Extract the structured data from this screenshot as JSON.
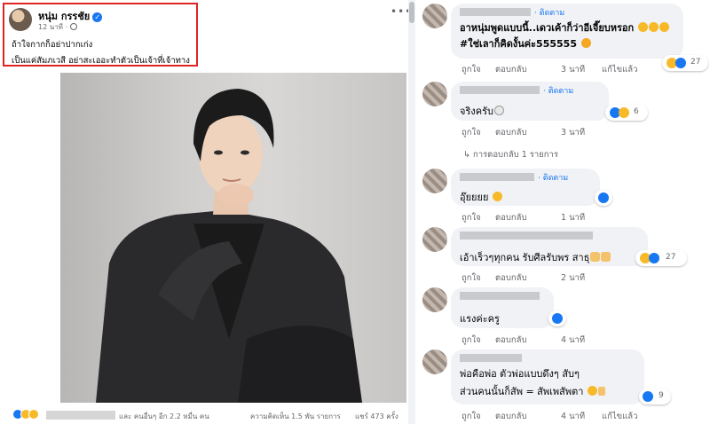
{
  "post": {
    "author": "หนุ่ม กรรชัย",
    "time": "12 นาที ·",
    "text_line_1": "ถ้าใจกากก็อย่าปากเก่ง",
    "text_line_2": "เป็นแค่สัมภเวสี อย่าสะเออะทำตัวเป็นเจ้าที่เจ้าทาง",
    "more_icon": "•••",
    "reaction_summary": "และ คนอื่นๆ อีก 2.2 หมื่น คน",
    "comment_count": "ความคิดเห็น 1.5 พัน รายการ",
    "share_count": "แชร์ 473 ครั้ง",
    "reaction_icons": [
      "like-icon",
      "haha-icon",
      "wow-icon"
    ]
  },
  "comments": [
    {
      "follow": "· ติดตาม",
      "text_lines": [
        "อาหนุ่มพูดแบบนี้..เดวเค้าก็ว่าอีเจี๊ยบหรอก",
        "#ใช่เลาก็คิดงั้นค่ะ555555"
      ],
      "actions": [
        "ถูกใจ",
        "ตอบกลับ",
        "3 นาที",
        "แก้ไขแล้ว"
      ],
      "reactions": "27"
    },
    {
      "follow": "· ติดตาม",
      "text_lines": [
        "จริงครับ"
      ],
      "actions": [
        "ถูกใจ",
        "ตอบกลับ",
        "3 นาที"
      ],
      "reactions": "6",
      "replies": "การตอบกลับ 1 รายการ"
    },
    {
      "follow": "· ติดตาม",
      "text_lines": [
        "อุ๊ยยยย"
      ],
      "actions": [
        "ถูกใจ",
        "ตอบกลับ",
        "1 นาที"
      ],
      "reactions": ""
    },
    {
      "follow": "",
      "text_lines": [
        "เอ้าเร็วๆทุกคน รับศีลรับพร สาธุ"
      ],
      "actions": [
        "ถูกใจ",
        "ตอบกลับ",
        "2 นาที"
      ],
      "reactions": "27"
    },
    {
      "follow": "",
      "text_lines": [
        "แรงค่ะครู"
      ],
      "actions": [
        "ถูกใจ",
        "ตอบกลับ",
        "4 นาที"
      ],
      "reactions": ""
    },
    {
      "follow": "",
      "text_lines": [
        "พ่อคือพ่อ ตัวพ่อแบบดึงๆ สับๆ",
        "ส่วนคนนั้นก็สัพ = สัพเพสัพตา"
      ],
      "actions": [
        "ถูกใจ",
        "ตอบกลับ",
        "4 นาที",
        "แก้ไขแล้ว"
      ],
      "reactions": "9"
    }
  ],
  "colors": {
    "highlight_border": "#e02424",
    "link_blue": "#1877f2",
    "bubble_bg": "#f0f2f5",
    "meta_gray": "#65676b"
  }
}
